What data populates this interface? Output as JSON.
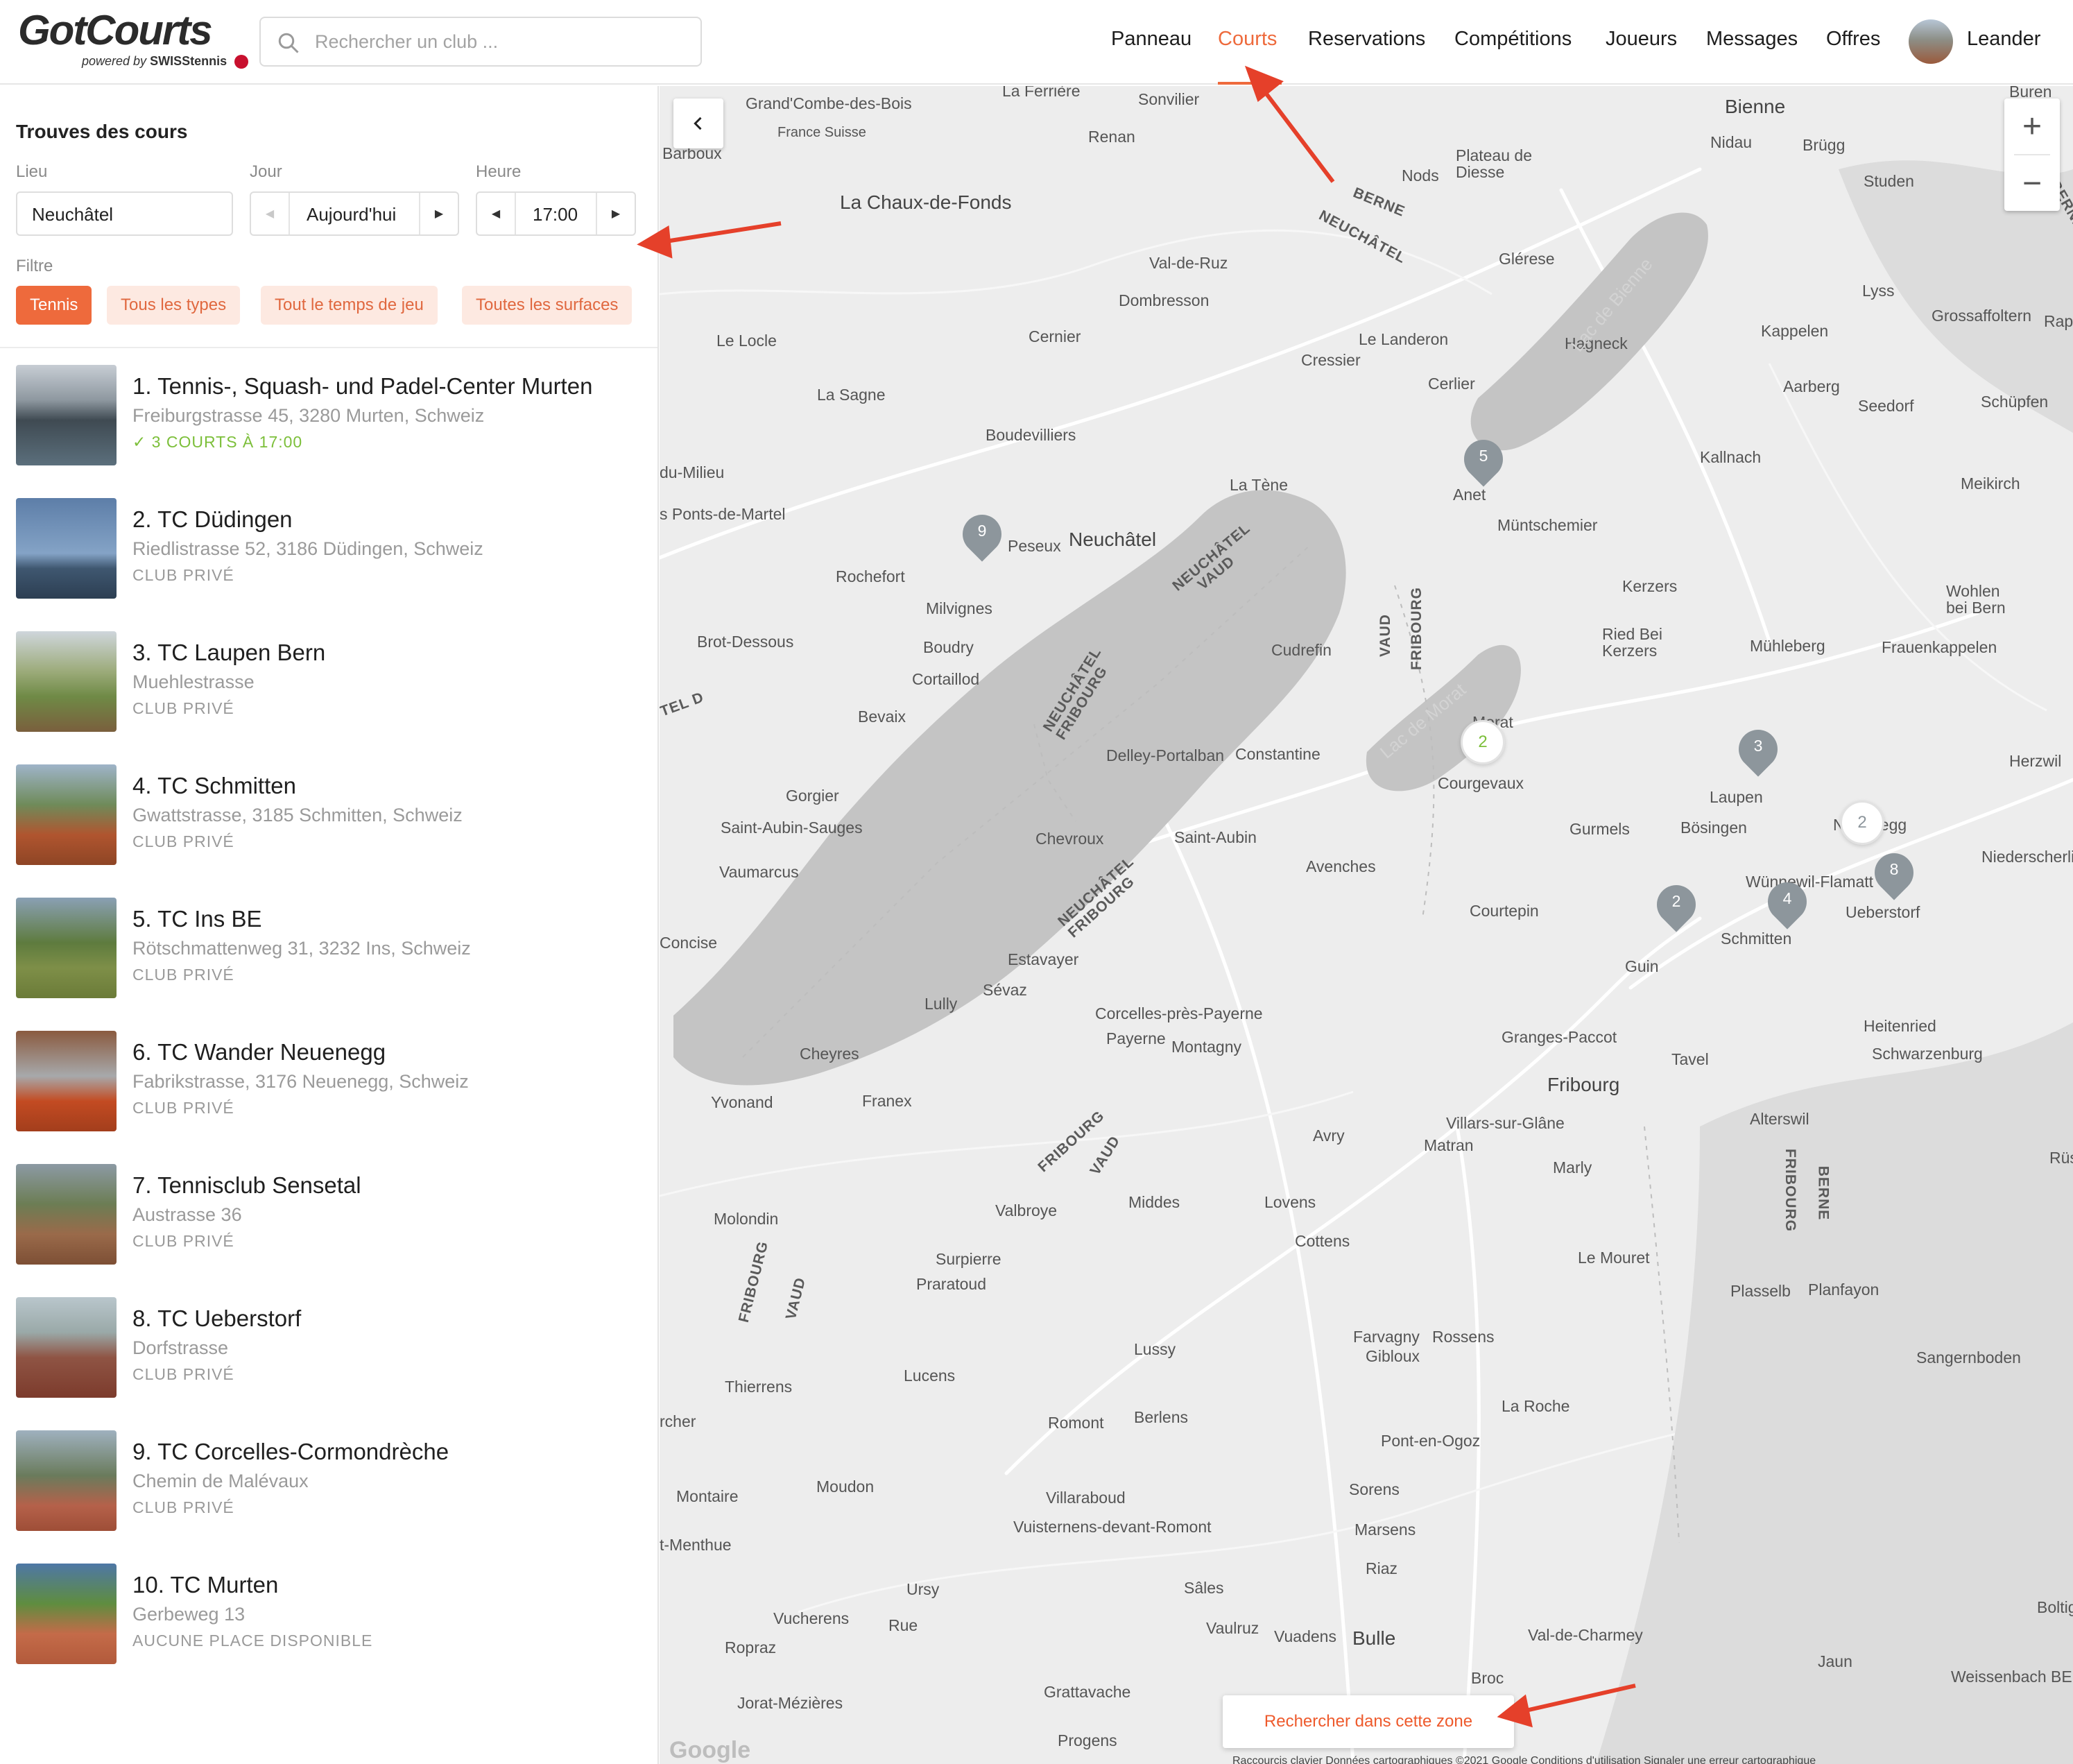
{
  "brand": {
    "name": "GotCourts",
    "powered_by": "powered by",
    "powered_brand": "SWISStennis"
  },
  "search": {
    "placeholder": "Rechercher un club ..."
  },
  "nav": {
    "items": [
      {
        "label": "Panneau"
      },
      {
        "label": "Courts"
      },
      {
        "label": "Reservations"
      },
      {
        "label": "Compétitions"
      },
      {
        "label": "Joueurs"
      },
      {
        "label": "Messages"
      },
      {
        "label": "Offres"
      }
    ],
    "active": "Courts",
    "user": "Leander"
  },
  "sidebar": {
    "title": "Trouves des cours",
    "location_label": "Lieu",
    "location_value": "Neuchâtel",
    "day_label": "Jour",
    "day_value": "Aujourd'hui",
    "time_label": "Heure",
    "time_value": "17:00",
    "filter_label": "Filtre",
    "filters": [
      "Tennis",
      "Tous les types",
      "Tout le temps de jeu",
      "Toutes les surfaces"
    ]
  },
  "clubs": [
    {
      "name": "1. Tennis-, Squash- und Padel-Center Murten",
      "address": "Freiburgstrasse 45, 3280 Murten, Schweiz",
      "status": "✓ 3 COURTS À 17:00"
    },
    {
      "name": "2. TC Düdingen",
      "address": "Riedlistrasse 52, 3186 Düdingen, Schweiz",
      "status": "CLUB PRIVÉ"
    },
    {
      "name": "3. TC Laupen Bern",
      "address": "Muehlestrasse",
      "status": "CLUB PRIVÉ"
    },
    {
      "name": "4. TC Schmitten",
      "address": "Gwattstrasse, 3185 Schmitten, Schweiz",
      "status": "CLUB PRIVÉ"
    },
    {
      "name": "5. TC Ins BE",
      "address": "Rötschmattenweg 31, 3232 Ins, Schweiz",
      "status": "CLUB PRIVÉ"
    },
    {
      "name": "6. TC Wander Neuenegg",
      "address": "Fabrikstrasse, 3176 Neuenegg, Schweiz",
      "status": "CLUB PRIVÉ"
    },
    {
      "name": "7. Tennisclub Sensetal",
      "address": "Austrasse 36",
      "status": "CLUB PRIVÉ"
    },
    {
      "name": "8. TC Ueberstorf",
      "address": "Dorfstrasse",
      "status": "CLUB PRIVÉ"
    },
    {
      "name": "9. TC Corcelles-Cormondrèche",
      "address": "Chemin de Malévaux",
      "status": "CLUB PRIVÉ"
    },
    {
      "name": "10. TC Murten",
      "address": "Gerbeweg 13",
      "status": "AUCUNE PLACE DISPONIBLE"
    }
  ],
  "map": {
    "places": [
      "Grand'Combe-des-Bois",
      "La Ferrière",
      "Sonvilier",
      "Bienne",
      "Renan",
      "France Suisse",
      "Barboux",
      "Plateau de Diesse",
      "Nods",
      "Nidau",
      "Brügg",
      "Studen",
      "La Chaux-de-Fonds",
      "Glérese",
      "Val-de-Ruz",
      "Dombresson",
      "Lyss",
      "Grossaffoltern",
      "Le Locle",
      "Cernier",
      "Le Landeron",
      "Cressier",
      "Hagneck",
      "Kappelen",
      "La Sagne",
      "Cerlier",
      "Aarberg",
      "Seedorf",
      "Schüpfen",
      "Boudevilliers",
      "Anet",
      "Kallnach",
      "Meikirch",
      "du-Milieu",
      "La Tène",
      "s Ponts-de-Martel",
      "Müntschemier",
      "Peseux",
      "Neuchâtel",
      "Rochefort",
      "Kerzers",
      "Wohlen bei Bern",
      "Milvignes",
      "Ried Bei Kerzers",
      "Mühleberg",
      "Frauenkappelen",
      "Brot-Dessous",
      "Boudry",
      "Cudrefin",
      "Cortaillod",
      "Bevaix",
      "Morat",
      "Delley-Portalban",
      "Constantine",
      "Herzwil",
      "Courgevaux",
      "Laupen",
      "Gorgier",
      "Saint-Aubin-Sauges",
      "Chevroux",
      "Saint-Aubin",
      "Gurmels",
      "Bösingen",
      "Neuenegg",
      "Niederscherli",
      "Vaumarcus",
      "Avenches",
      "Wünnewil-Flamatt",
      "Ueberstorf",
      "Courtepin",
      "Schmitten",
      "Concise",
      "Estavayer",
      "Guin",
      "Sévaz",
      "Lully",
      "Heitenried",
      "Corcelles-près-Payerne",
      "Payerne",
      "Montagny",
      "Granges-Paccot",
      "Schwarzenburg",
      "Tavel",
      "Cheyres",
      "Fribourg",
      "Yvonand",
      "Franex",
      "Alterswil",
      "Villars-sur-Glâne",
      "Avry",
      "Matran",
      "Marly",
      "Rüsch",
      "Valbroye",
      "Middes",
      "Lovens",
      "Molondin",
      "Cottens",
      "Surpierre",
      "Le Mouret",
      "Praratoud",
      "Plasselb",
      "Planfayon",
      "Farvagny",
      "Gibloux",
      "Rossens",
      "Lussy",
      "Sangernboden",
      "Lucens",
      "Thierrens",
      "La Roche",
      "rcher",
      "Romont",
      "Berlens",
      "Pont-en-Ogoz",
      "Montaire",
      "Moudon",
      "Villaraboud",
      "Sorens",
      "Vuisternens-devant-Romont",
      "Marsens",
      "t-Menthue",
      "Riaz",
      "Sâles",
      "Ursy",
      "Boltigen",
      "Vucherens",
      "Rue",
      "Vaulruz",
      "Vuadens",
      "Bulle",
      "Val-de-Charmey",
      "Ropraz",
      "Jaun",
      "Broc",
      "Weissenbach BE",
      "Grattavache",
      "Jorat-Mézières",
      "Progens",
      "Buren an der",
      "Rap"
    ],
    "borders": [
      "BERNE",
      "NEUCHÂTEL",
      "NEUCHÂTEL VAUD",
      "NEUCHÂTEL FRIBOURG",
      "VAUD",
      "FRIBOURG",
      "BERNE",
      "TEL D"
    ],
    "lakes": [
      "Lac de Bienne",
      "Lac de Morat"
    ],
    "markers": [
      "5",
      "9",
      "3",
      "2",
      "4",
      "8"
    ],
    "clusters": [
      "2",
      "2"
    ],
    "search_area_label": "Rechercher dans cette zone",
    "google_label": "Google",
    "attribution": "Raccourcis clavier  Données cartographiques ©2021 Google  Conditions d'utilisation  Signaler une erreur cartographique"
  },
  "colors": {
    "accent": "#ee6a3c",
    "accent_soft": "#fde9e1",
    "available": "#7cbf3a",
    "muted": "#9a9a9a",
    "map_land": "#ededed",
    "map_lake": "#c4c4c4",
    "marker": "#8d969c"
  },
  "icons": [
    "search-icon",
    "chevron-left-icon",
    "chevron-right-icon",
    "check-icon",
    "plus-icon",
    "minus-icon",
    "map-marker-icon"
  ]
}
